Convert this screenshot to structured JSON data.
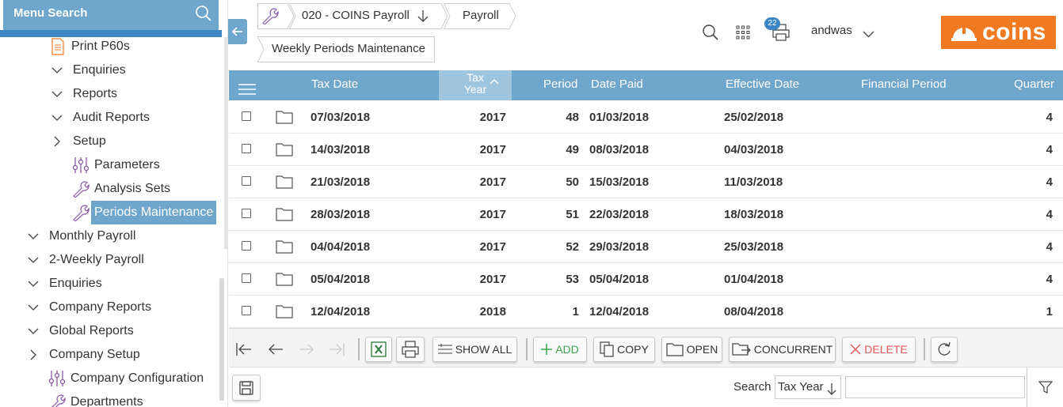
{
  "sidebar": {
    "search_label": "Menu Search",
    "items": [
      {
        "label": "Print P60s",
        "icon": "document-icon"
      },
      {
        "label": "Enquiries",
        "icon": "chevron-down-icon"
      },
      {
        "label": "Reports",
        "icon": "chevron-down-icon"
      },
      {
        "label": "Audit Reports",
        "icon": "chevron-down-icon"
      },
      {
        "label": "Setup",
        "icon": "chevron-right-icon"
      },
      {
        "label": "Parameters",
        "icon": "sliders-icon"
      },
      {
        "label": "Analysis Sets",
        "icon": "wrench-icon"
      },
      {
        "label": "Periods Maintenance",
        "icon": "wrench-icon",
        "selected": true
      },
      {
        "label": "Monthly Payroll",
        "icon": "chevron-down-icon"
      },
      {
        "label": "2-Weekly Payroll",
        "icon": "chevron-down-icon"
      },
      {
        "label": "Enquiries",
        "icon": "chevron-down-icon"
      },
      {
        "label": "Company Reports",
        "icon": "chevron-down-icon"
      },
      {
        "label": "Global Reports",
        "icon": "chevron-down-icon"
      },
      {
        "label": "Company Setup",
        "icon": "chevron-right-icon"
      },
      {
        "label": "Company Configuration",
        "icon": "sliders-icon"
      },
      {
        "label": "Departments",
        "icon": "wrench-icon"
      }
    ]
  },
  "breadcrumb": {
    "company": "020 - COINS Payroll",
    "module": "Payroll",
    "page": "Weekly Periods Maintenance"
  },
  "header": {
    "notification_count": "22",
    "user": "andwas",
    "logo_text": "coins"
  },
  "grid": {
    "columns": {
      "tax_date": "Tax Date",
      "tax_year_line1": "Tax",
      "tax_year_line2": "Year",
      "period": "Period",
      "date_paid": "Date Paid",
      "effective_date": "Effective Date",
      "financial_period": "Financial Period",
      "quarter": "Quarter"
    },
    "rows": [
      {
        "tax_date": "07/03/2018",
        "tax_year": "2017",
        "period": "48",
        "date_paid": "01/03/2018",
        "effective_date": "25/02/2018",
        "financial_period": "",
        "quarter": "4"
      },
      {
        "tax_date": "14/03/2018",
        "tax_year": "2017",
        "period": "49",
        "date_paid": "08/03/2018",
        "effective_date": "04/03/2018",
        "financial_period": "",
        "quarter": "4"
      },
      {
        "tax_date": "21/03/2018",
        "tax_year": "2017",
        "period": "50",
        "date_paid": "15/03/2018",
        "effective_date": "11/03/2018",
        "financial_period": "",
        "quarter": "4"
      },
      {
        "tax_date": "28/03/2018",
        "tax_year": "2017",
        "period": "51",
        "date_paid": "22/03/2018",
        "effective_date": "18/03/2018",
        "financial_period": "",
        "quarter": "4"
      },
      {
        "tax_date": "04/04/2018",
        "tax_year": "2017",
        "period": "52",
        "date_paid": "29/03/2018",
        "effective_date": "25/03/2018",
        "financial_period": "",
        "quarter": "4"
      },
      {
        "tax_date": "05/04/2018",
        "tax_year": "2017",
        "period": "53",
        "date_paid": "05/04/2018",
        "effective_date": "01/04/2018",
        "financial_period": "",
        "quarter": "4"
      },
      {
        "tax_date": "12/04/2018",
        "tax_year": "2018",
        "period": "1",
        "date_paid": "12/04/2018",
        "effective_date": "08/04/2018",
        "financial_period": "",
        "quarter": "1"
      }
    ]
  },
  "toolbar": {
    "show_all": "SHOW ALL",
    "add": "ADD",
    "copy": "COPY",
    "open": "OPEN",
    "concurrent": "CONCURRENT",
    "delete": "DELETE"
  },
  "search": {
    "label": "Search",
    "field": "Tax Year",
    "value": ""
  },
  "colors": {
    "accent": "#6fa6cc",
    "sorted_header": "#9fc4de",
    "brand": "#f07a22",
    "add": "#3aa64b",
    "delete": "#e05555"
  }
}
